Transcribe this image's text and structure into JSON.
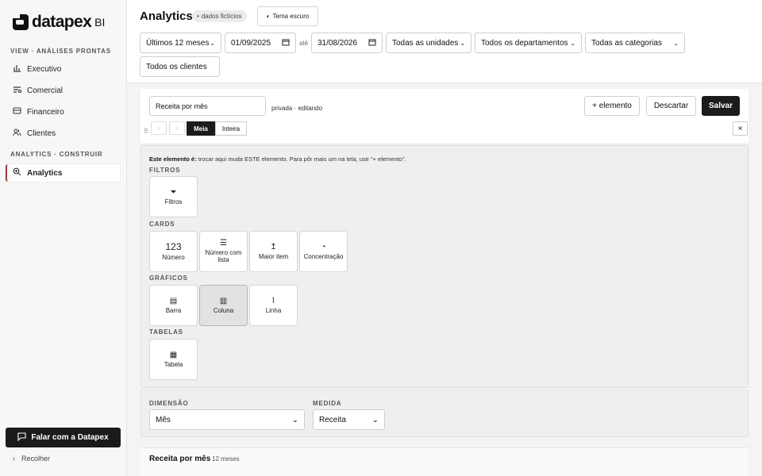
{
  "sidebar": {
    "logo_text": "datapex",
    "logo_suffix": "BI",
    "section1": "VIEW · ANÁLISES PRONTAS",
    "items": [
      {
        "label": "Executivo",
        "icon": "bar-chart-icon"
      },
      {
        "label": "Comercial",
        "icon": "filter-lines-icon"
      },
      {
        "label": "Financeiro",
        "icon": "card-icon"
      },
      {
        "label": "Clientes",
        "icon": "users-icon"
      }
    ],
    "section2": "ANALYTICS · CONSTRUIR",
    "active_item": {
      "label": "Analytics",
      "icon": "zoom-icon"
    },
    "cta_label": "Falar com a Datapex",
    "collapse_label": "Recolher"
  },
  "header": {
    "title": "Analytics",
    "badge": "dados fictícios",
    "theme_button": "Tema escuro",
    "period": "Últimos 12 meses",
    "date_from": "01/09/2025",
    "date_sep": "até",
    "date_to": "31/08/2026",
    "units": "Todas as unidades",
    "departments": "Todos os departamentos",
    "categories": "Todas as categorias",
    "clients": "Todos os clientes"
  },
  "editor": {
    "name_value": "Receita por mês",
    "status": "privada · editando",
    "add_button": "+ elemento",
    "discard_button": "Descartar",
    "save_button": "Salvar",
    "size_half": "Meia",
    "size_full": "Inteira",
    "close": "×"
  },
  "picker": {
    "hint_bold": "Este elemento é:",
    "hint_text": "trocar aqui muda ESTE elemento. Para pôr mais um na tela, use \"+ elemento\".",
    "groups": {
      "filters": "FILTROS",
      "cards": "CARDS",
      "charts": "GRÁFICOS",
      "tables": "TABELAS"
    },
    "tiles": {
      "filtros": {
        "label": "Filtros",
        "glyph": "⏷"
      },
      "numero": {
        "label": "Número",
        "glyph": "123"
      },
      "numero_lista": {
        "label": "Número com lista",
        "glyph": "☰"
      },
      "maior_item": {
        "label": "Maior item",
        "glyph": "↥"
      },
      "concentracao": {
        "label": "Concentração",
        "glyph": "◔"
      },
      "barra": {
        "label": "Barra",
        "glyph": "▤"
      },
      "coluna": {
        "label": "Coluna",
        "glyph": "▥"
      },
      "linha": {
        "label": "Linha",
        "glyph": "⌇"
      },
      "tabela": {
        "label": "Tabela",
        "glyph": "▦"
      }
    },
    "selected": "Coluna"
  },
  "dims": {
    "dimension_label": "DIMENSÃO",
    "dimension_value": "Mês",
    "measure_label": "MEDIDA",
    "measure_value": "Receita"
  },
  "preview": {
    "title": "Receita por mês",
    "subtitle": "12 meses"
  }
}
